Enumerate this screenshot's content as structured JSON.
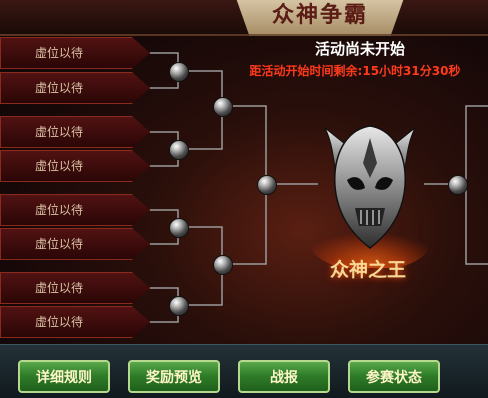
{
  "header": {
    "title": "众神争霸"
  },
  "status": {
    "title": "活动尚未开始",
    "countdown": "距活动开始时间剩余:15小时31分30秒"
  },
  "bracket": {
    "slots": [
      "虚位以待",
      "虚位以待",
      "虚位以待",
      "虚位以待",
      "虚位以待",
      "虚位以待",
      "虚位以待",
      "虚位以待"
    ]
  },
  "emblem": {
    "title": "众神之王"
  },
  "buttons": {
    "rules": "详细规则",
    "rewards": "奖励预览",
    "battle_report": "战报",
    "entry_status": "参赛状态"
  },
  "icons": [
    "skull-helmet-emblem-icon",
    "bracket-node-icon"
  ],
  "colors": {
    "countdown": "#ff3a1c",
    "button": "#2f7e29",
    "slot": "#511212"
  }
}
